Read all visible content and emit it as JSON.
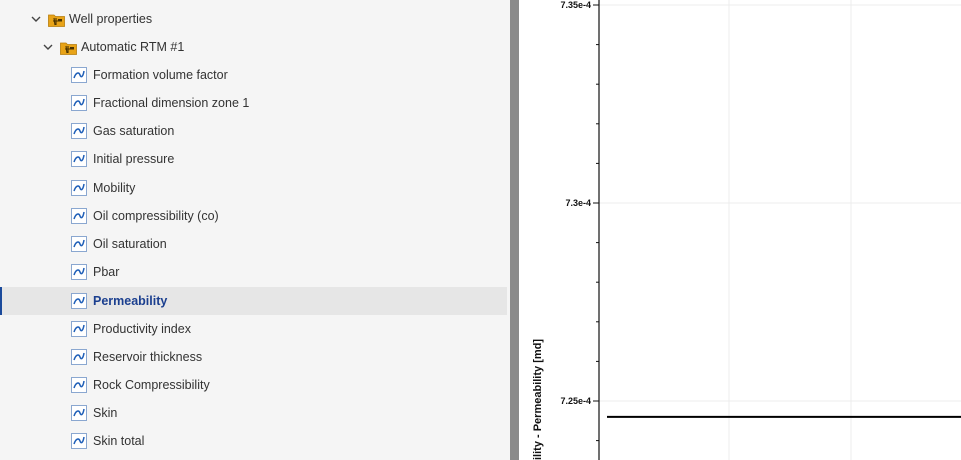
{
  "tree": {
    "groups": [
      {
        "label": "Well properties",
        "expanded": true
      },
      {
        "label": "Automatic RTM #1",
        "expanded": true
      }
    ],
    "items": [
      {
        "label": "Formation volume factor"
      },
      {
        "label": "Fractional dimension zone 1"
      },
      {
        "label": "Gas saturation"
      },
      {
        "label": "Initial pressure"
      },
      {
        "label": "Mobility"
      },
      {
        "label": "Oil compressibility (co)"
      },
      {
        "label": "Oil saturation"
      },
      {
        "label": "Pbar"
      },
      {
        "label": "Permeability",
        "selected": true
      },
      {
        "label": "Productivity index"
      },
      {
        "label": "Reservoir thickness"
      },
      {
        "label": "Rock Compressibility"
      },
      {
        "label": "Skin"
      },
      {
        "label": "Skin total"
      }
    ],
    "icons": {
      "group": "well-folder-icon",
      "item": "curve-icon",
      "expand": "chevron-down-icon"
    },
    "colors": {
      "selected_text": "#1b3f8f",
      "selected_bar": "#1b4a9b",
      "icon": "#1f5fb8",
      "folder": "#e8a317"
    }
  },
  "chart": {
    "y_axis_title": "ility - Permeability [md]"
  },
  "chart_data": {
    "type": "line",
    "ylabel": "ility - Permeability [md]",
    "y_ticks": [
      "7.35e-4",
      "7.3e-4",
      "7.25e-4"
    ],
    "y_tick_values": [
      0.000735,
      0.00073,
      0.000725
    ],
    "ylim": [
      0.000723,
      0.000735
    ],
    "grid": true,
    "series": [
      {
        "values": [
          0.0007246,
          0.0007246
        ]
      }
    ]
  }
}
